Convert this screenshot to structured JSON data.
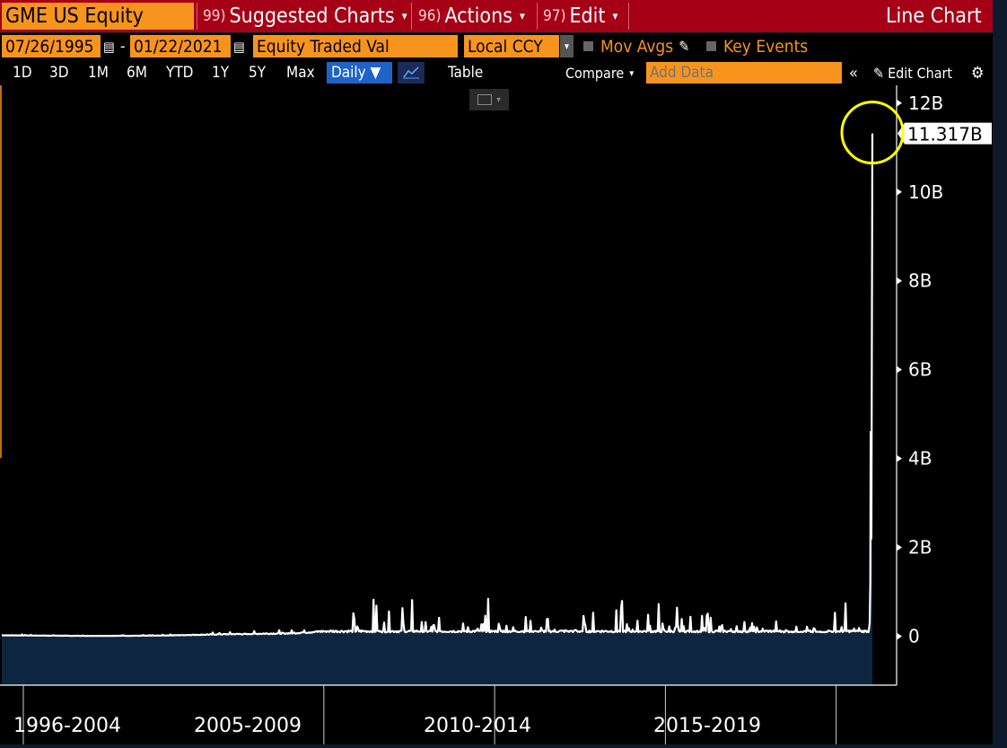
{
  "header": {
    "ticker": "GME US Equity",
    "menus": [
      {
        "num": "99)",
        "label": "Suggested Charts"
      },
      {
        "num": "96)",
        "label": "Actions"
      },
      {
        "num": "97)",
        "label": "Edit"
      }
    ],
    "chart_type_label": "Line Chart"
  },
  "settings": {
    "start_date": "07/26/1995",
    "date_separator": "-",
    "end_date": "01/22/2021",
    "field": "Equity Traded Val",
    "currency": "Local CCY",
    "mov_avgs": "Mov Avgs",
    "key_events": "Key Events"
  },
  "toolbar": {
    "periods": [
      "1D",
      "3D",
      "1M",
      "6M",
      "YTD",
      "1Y",
      "5Y",
      "Max"
    ],
    "frequency": "Daily ▼",
    "table": "Table",
    "compare": "Compare",
    "add_data_placeholder": "Add Data",
    "edit_chart": "Edit Chart",
    "collapse": "«"
  },
  "chart_data": {
    "type": "line",
    "series": [
      {
        "name": "Equity Traded Val",
        "color": "#ffffff"
      }
    ],
    "y_ticks": [
      "12B",
      "10B",
      "8B",
      "6B",
      "4B",
      "2B",
      "0"
    ],
    "y_tick_values": [
      12,
      10,
      8,
      6,
      4,
      2,
      0
    ],
    "ylim": [
      -1.1,
      12.4
    ],
    "y_unit": "B",
    "x_labels": [
      "1996-2004",
      "2005-2009",
      "2010-2014",
      "2015-2019"
    ],
    "xlim": [
      1995.57,
      2021.06
    ],
    "last_value_label": "11.317B",
    "last_value": 11.317,
    "key_points": [
      {
        "x": 1995.57,
        "y": 0.05
      },
      {
        "x": 1998.0,
        "y": 0.02
      },
      {
        "x": 2000.0,
        "y": 0.03
      },
      {
        "x": 2002.0,
        "y": 0.1
      },
      {
        "x": 2004.0,
        "y": 0.15
      },
      {
        "x": 2005.5,
        "y": 0.3
      },
      {
        "x": 2006.6,
        "y": 1.1
      },
      {
        "x": 2007.4,
        "y": 0.9
      },
      {
        "x": 2008.7,
        "y": 0.6
      },
      {
        "x": 2009.8,
        "y": 0.85
      },
      {
        "x": 2012.0,
        "y": 0.35
      },
      {
        "x": 2014.0,
        "y": 0.9
      },
      {
        "x": 2015.2,
        "y": 0.7
      },
      {
        "x": 2016.5,
        "y": 0.6
      },
      {
        "x": 2018.0,
        "y": 0.4
      },
      {
        "x": 2019.5,
        "y": 0.2
      },
      {
        "x": 2020.5,
        "y": 1.1
      },
      {
        "x": 2020.9,
        "y": 0.6
      },
      {
        "x": 2021.0,
        "y": 4.6
      },
      {
        "x": 2021.06,
        "y": 11.317
      }
    ],
    "highlight": {
      "x": 2021.06,
      "y": 11.317,
      "color": "#ffff00"
    },
    "fill_color": "#0e2540",
    "line_color": "#ffffff",
    "grid": false
  }
}
